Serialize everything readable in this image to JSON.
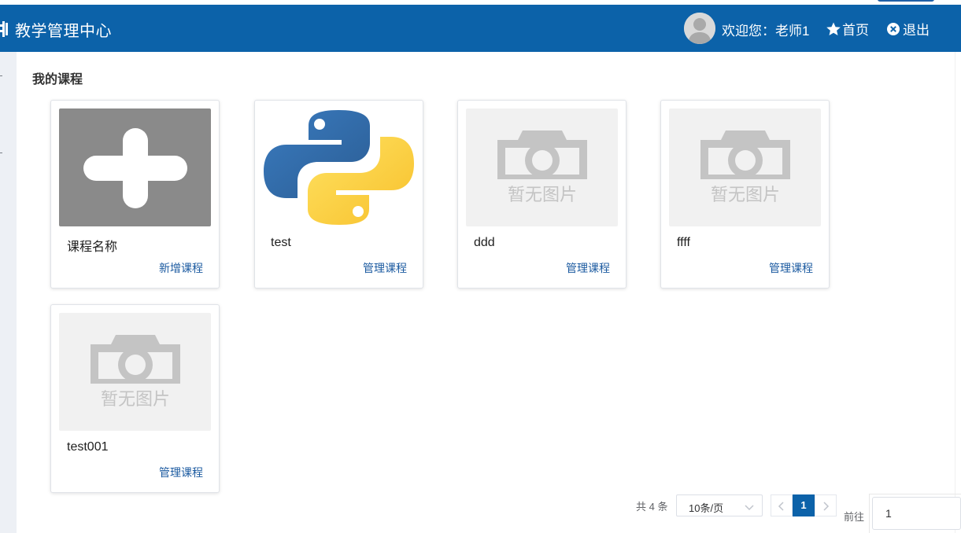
{
  "header": {
    "title": "教学管理中心",
    "welcome": "欢迎您：老师1",
    "home_label": "首页",
    "logout_label": "退出",
    "logo_icon": "logo-icon",
    "avatar_icon": "user-avatar-icon",
    "home_icon": "star-icon",
    "logout_icon": "close-circle-icon",
    "bg_color": "#0c62a9"
  },
  "main": {
    "section_title": "我的课程",
    "courses": [
      {
        "name": "课程名称",
        "action": "新增课程",
        "thumb": "add-course-icon"
      },
      {
        "name": "test",
        "action": "管理课程",
        "thumb": "python-logo"
      },
      {
        "name": "ddd",
        "action": "管理课程",
        "thumb": "no-image-placeholder",
        "thumb_text": "暂无图片"
      },
      {
        "name": "ffff",
        "action": "管理课程",
        "thumb": "no-image-placeholder",
        "thumb_text": "暂无图片"
      },
      {
        "name": "test001",
        "action": "管理课程",
        "thumb": "no-image-placeholder",
        "thumb_text": "暂无图片"
      }
    ]
  },
  "pagination": {
    "total": "共 4 条",
    "page_size": "10条/页",
    "current_page": "1",
    "goto_label": "前往",
    "goto_value": "1",
    "accent_color": "#0c62a9"
  }
}
